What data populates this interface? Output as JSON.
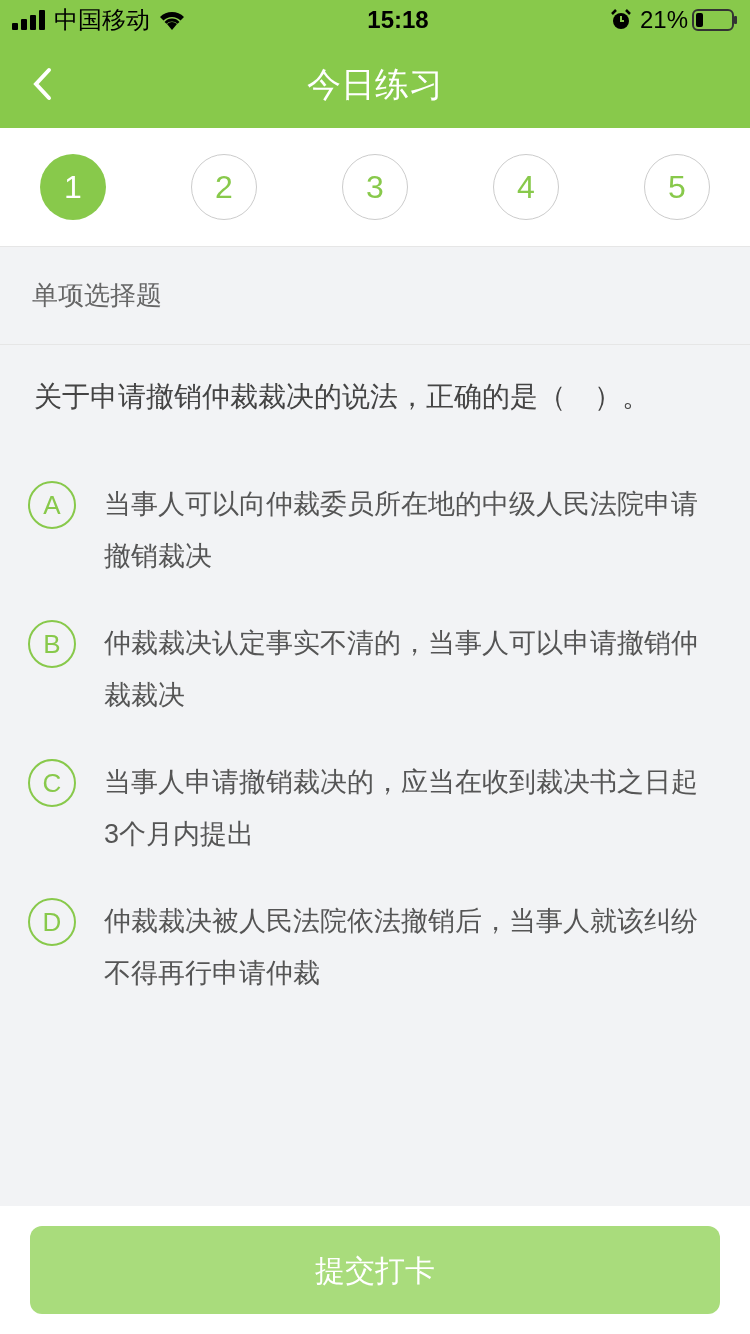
{
  "status_bar": {
    "carrier": "中国移动",
    "time": "15:18",
    "battery": "21%"
  },
  "nav": {
    "title": "今日练习"
  },
  "steps": [
    {
      "label": "1",
      "selected": true
    },
    {
      "label": "2",
      "selected": false
    },
    {
      "label": "3",
      "selected": false
    },
    {
      "label": "4",
      "selected": false
    },
    {
      "label": "5",
      "selected": false
    }
  ],
  "section_label": "单项选择题",
  "question": "关于申请撤销仲裁裁决的说法，正确的是（　）。",
  "options": [
    {
      "letter": "A",
      "text": "当事人可以向仲裁委员所在地的中级人民法院申请撤销裁决",
      "selected": false
    },
    {
      "letter": "B",
      "text": "仲裁裁决认定事实不清的，当事人可以申请撤销仲裁裁决",
      "selected": false
    },
    {
      "letter": "C",
      "text": "当事人申请撤销裁决的，应当在收到裁决书之日起3个月内提出",
      "selected": false
    },
    {
      "letter": "D",
      "text": "仲裁裁决被人民法院依法撤销后，当事人就该纠纷不得再行申请仲裁",
      "selected": false
    }
  ],
  "submit": {
    "label": "提交打卡",
    "disabled": true
  }
}
